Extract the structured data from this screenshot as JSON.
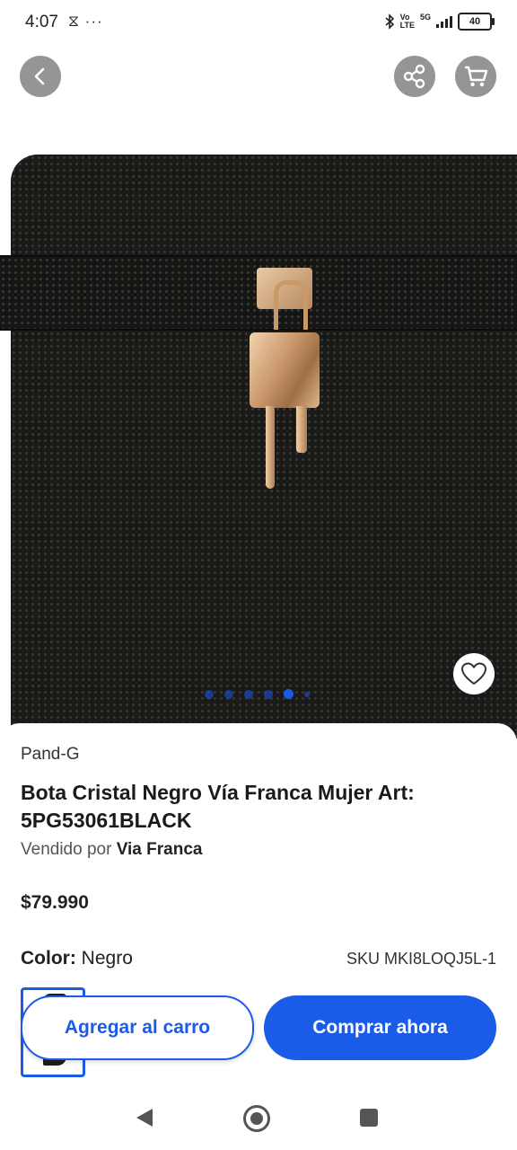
{
  "status_bar": {
    "time": "4:07",
    "left_icons": "⧖ ···",
    "network_vo": "Vo",
    "network_lte": "LTE",
    "network_5g": "5G",
    "battery": "40"
  },
  "hero": {
    "image_index_total": 6,
    "image_index_active": 5
  },
  "product": {
    "brand": "Pand-G",
    "title": "Bota Cristal Negro Vía Franca Mujer Art: 5PG53061BLACK",
    "seller_prefix": "Vendido por",
    "seller_name": "Via Franca",
    "price": "$79.990",
    "color_label": "Color:",
    "color_value": "Negro",
    "sku": "SKU MKI8LOQJ5L-1"
  },
  "actions": {
    "add_to_cart": "Agregar al carro",
    "buy_now": "Comprar ahora"
  },
  "colors": {
    "accent": "#1a5ce8",
    "overlay_button": "#828282"
  },
  "icons": {
    "back": "chevron-left-icon",
    "share": "share-icon",
    "cart": "cart-icon",
    "favorite": "heart-icon"
  }
}
